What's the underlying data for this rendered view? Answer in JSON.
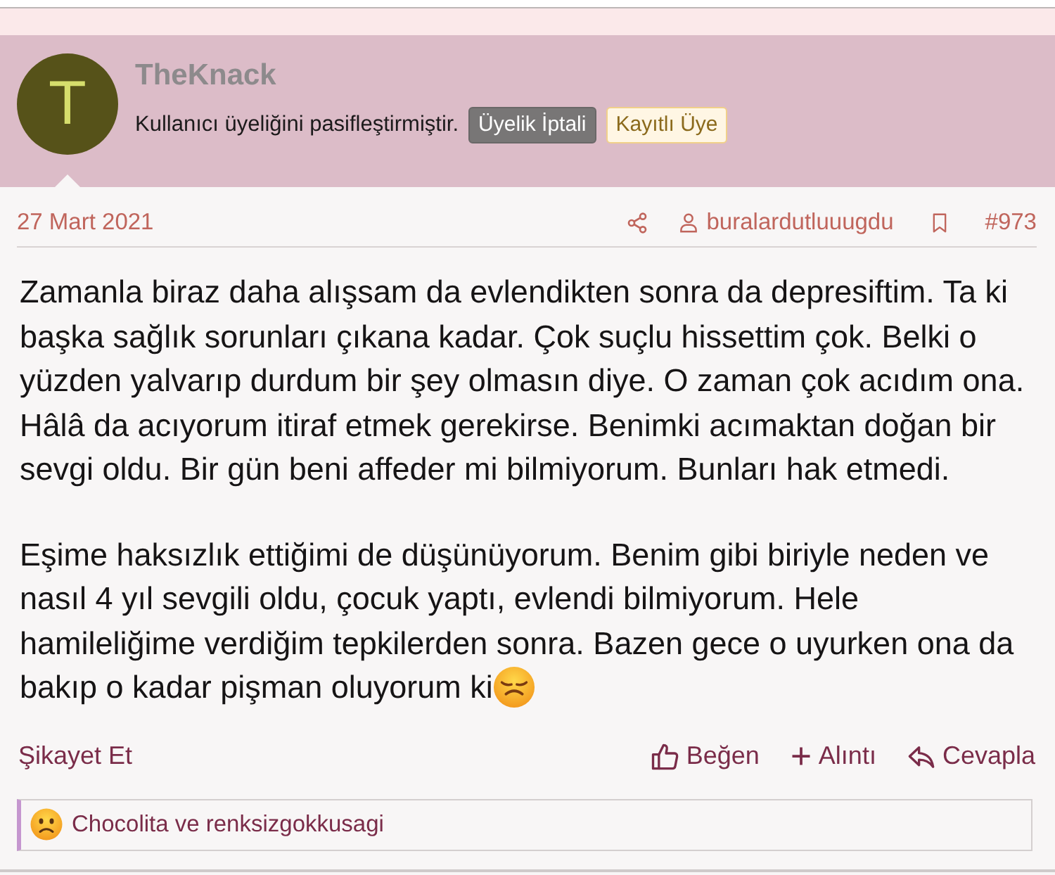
{
  "author": {
    "avatar_letter": "T",
    "name": "TheKnack",
    "status": "Kullanıcı üyeliğini pasifleştirmiştir.",
    "badges": [
      {
        "label": "Üyelik İptali",
        "kind": "cancelled"
      },
      {
        "label": "Kayıtlı Üye",
        "kind": "registered"
      }
    ]
  },
  "meta": {
    "date": "27 Mart 2021",
    "user": "buralardutluuugdu",
    "post_number": "#973"
  },
  "paragraphs": [
    {
      "text": "Zamanla biraz daha alışsam da evlendikten sonra da depresiftim. Ta ki başka sağlık sorunları çıkana kadar. Çok suçlu hissettim çok. Belki o yüzden yalvarıp durdum bir şey olmasın diye. O zaman çok acıdım ona. Hâlâ da acıyorum itiraf etmek gerekirse. Benimki acımaktan doğan bir sevgi oldu. Bir gün beni affeder mi bilmiyorum. Bunları hak etmedi.",
      "trailing_emoji": false
    },
    {
      "text": "Eşime haksızlık ettiğimi de düşünüyorum. Benim gibi biriyle neden ve nasıl 4 yıl sevgili oldu, çocuk yaptı, evlendi bilmiyorum. Hele hamileliğime verdiğim tepkilerden sonra. Bazen gece o uyurken ona da bakıp o kadar pişman oluyorum ki",
      "trailing_emoji": true
    }
  ],
  "actions": {
    "report": "Şikayet Et",
    "buttons": [
      {
        "label": "Beğen",
        "kind": "like"
      },
      {
        "label": "Alıntı",
        "kind": "quote"
      },
      {
        "label": "Cevapla",
        "kind": "reply"
      }
    ]
  },
  "reactions": {
    "text": "Chocolita ve renksizgokkusagi"
  }
}
